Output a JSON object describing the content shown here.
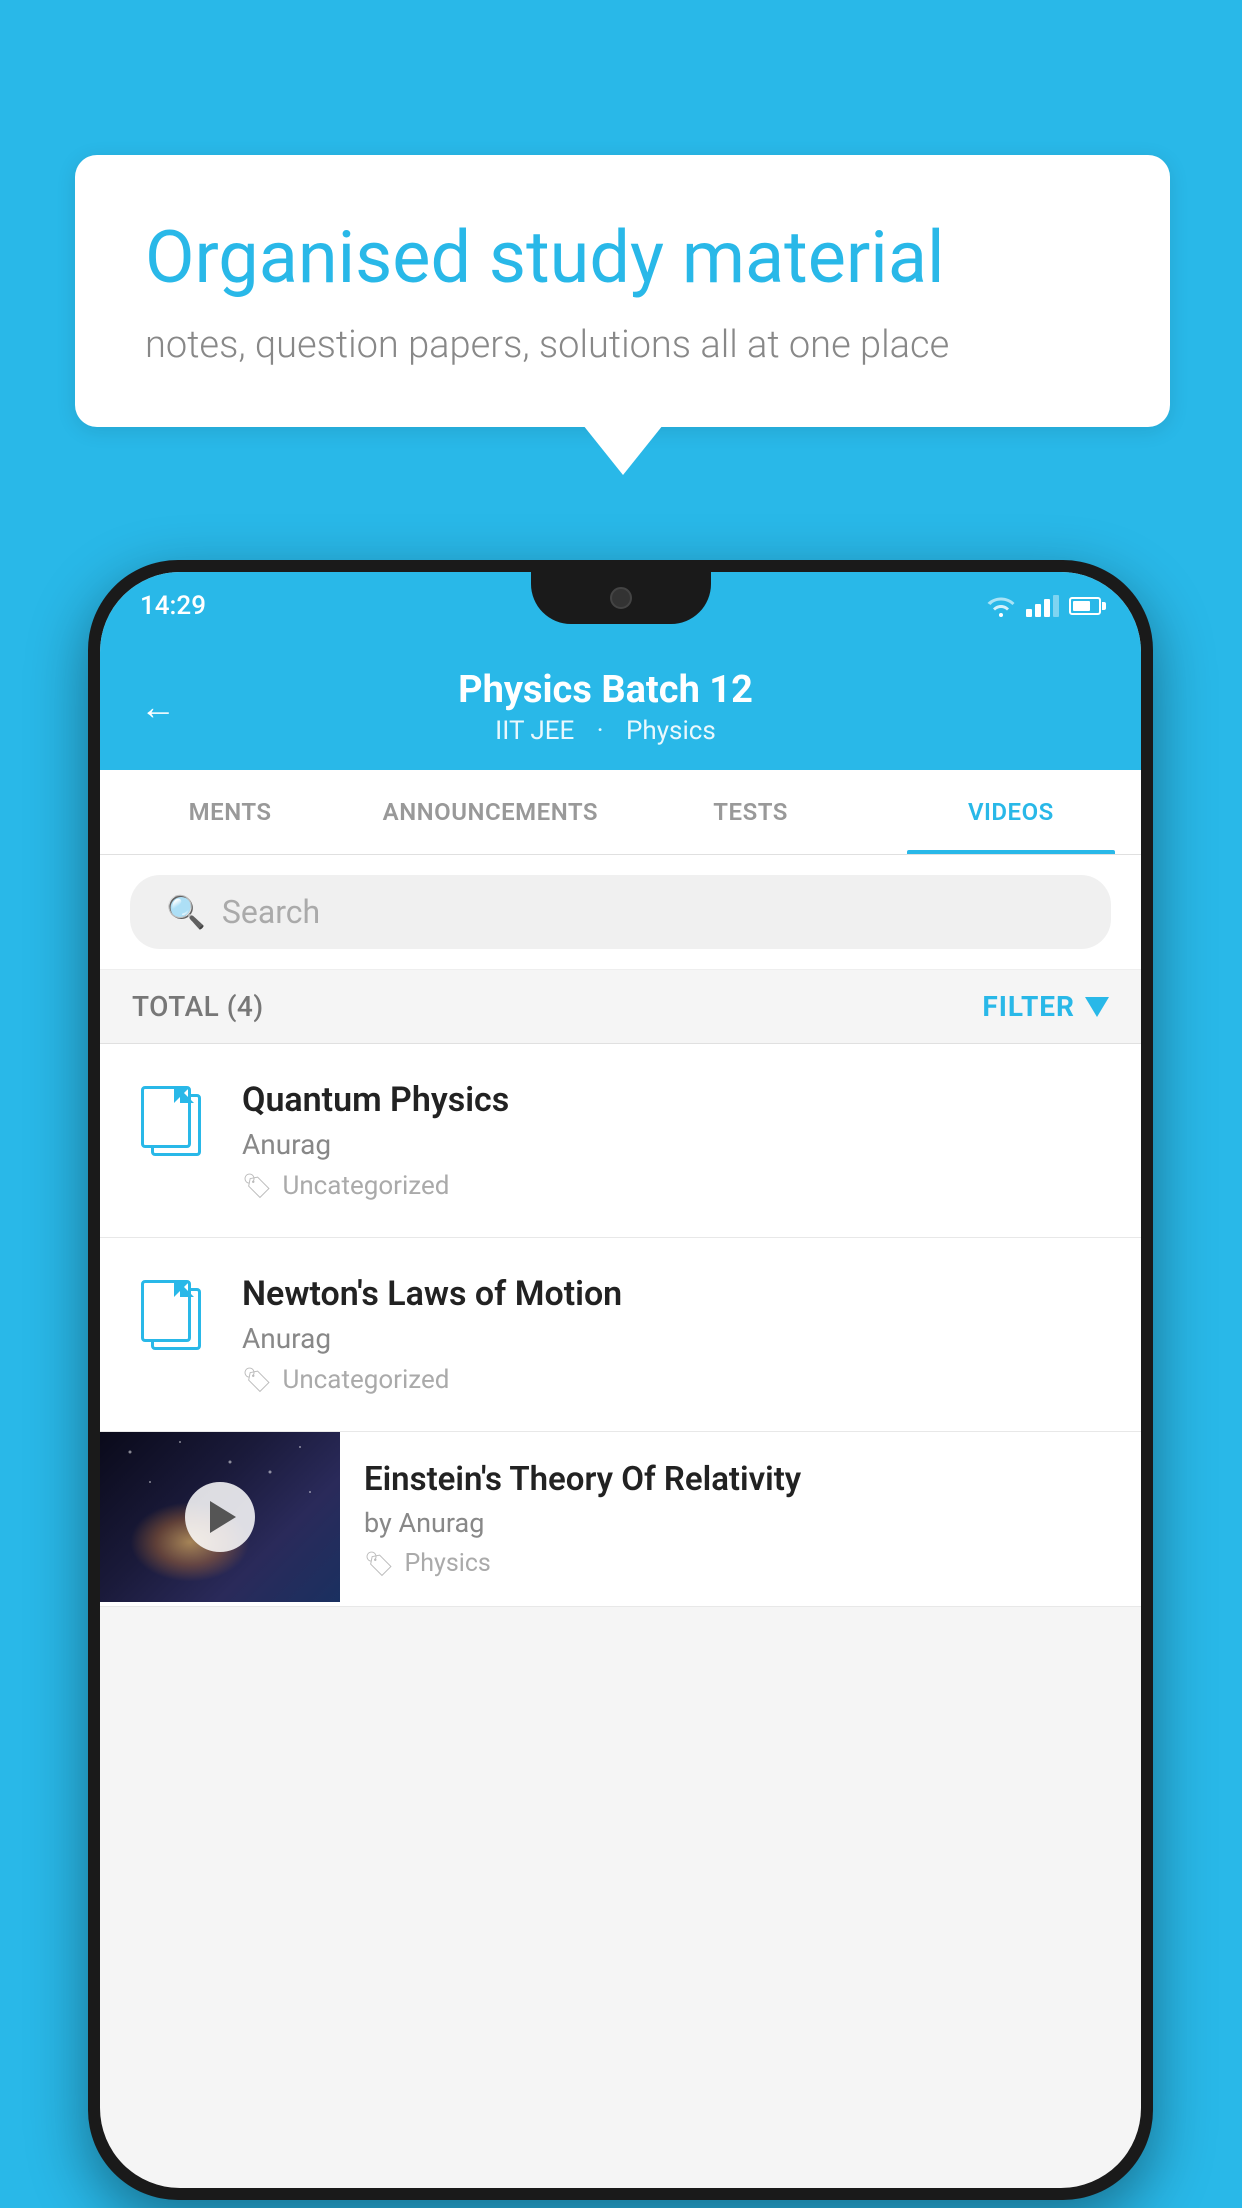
{
  "background": {
    "color": "#29b8e8"
  },
  "speech_bubble": {
    "heading": "Organised study material",
    "subtext": "notes, question papers, solutions all at one place"
  },
  "phone": {
    "status_bar": {
      "time": "14:29",
      "icons": [
        "wifi",
        "signal",
        "battery"
      ]
    },
    "header": {
      "back_label": "←",
      "title": "Physics Batch 12",
      "subtitle_part1": "IIT JEE",
      "subtitle_part2": "Physics"
    },
    "tabs": [
      {
        "label": "MENTS",
        "active": false
      },
      {
        "label": "ANNOUNCEMENTS",
        "active": false
      },
      {
        "label": "TESTS",
        "active": false
      },
      {
        "label": "VIDEOS",
        "active": true
      }
    ],
    "search": {
      "placeholder": "Search"
    },
    "filter_bar": {
      "total_label": "TOTAL (4)",
      "filter_label": "FILTER"
    },
    "items": [
      {
        "type": "file",
        "title": "Quantum Physics",
        "author": "Anurag",
        "tag": "Uncategorized"
      },
      {
        "type": "file",
        "title": "Newton's Laws of Motion",
        "author": "Anurag",
        "tag": "Uncategorized"
      },
      {
        "type": "thumbnail",
        "title": "Einstein's Theory Of Relativity",
        "author": "by Anurag",
        "tag": "Physics"
      }
    ]
  }
}
